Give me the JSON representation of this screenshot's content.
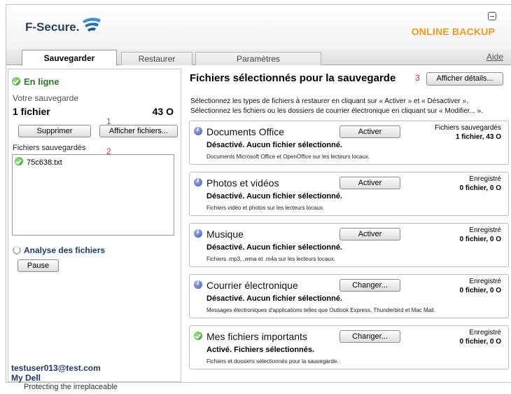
{
  "header": {
    "logo_text": "F-Secure.",
    "brand": "ONLINE BACKUP"
  },
  "tabs": [
    {
      "label": "Sauvegarder",
      "active": true
    },
    {
      "label": "Restaurer",
      "active": false
    },
    {
      "label": "Paramètres",
      "active": false
    }
  ],
  "help_label": "Aide",
  "left": {
    "status": "En ligne",
    "backup_label": "Votre sauvegarde",
    "file_count": "1 fichier",
    "size": "43 O",
    "delete_button": "Supprimer",
    "show_files_button": "Afficher fichiers...",
    "marker_1": "1",
    "marker_2": "2",
    "saved_files_label": "Fichiers sauvegardés",
    "files": [
      "75c638.txt"
    ],
    "analysis_label": "Analyse des fichiers",
    "pause_button": "Pause",
    "user_email": "testuser013@test.com",
    "user_link": "My Dell"
  },
  "main": {
    "title": "Fichiers sélectionnés pour la sauvegarde",
    "marker_3": "3",
    "details_button": "Afficher détails...",
    "desc_line1": "Sélectionnez les types de fichiers à restaurer en cliquant sur « Activer » et « Désactiver ».",
    "desc_line2": "Sélectionnez les fichiers ou les dossiers de courrier électronique en cliquant sur « Modifier... ».",
    "cards": [
      {
        "title": "Documents Office",
        "state": "Désactivé. Aucun fichier sélectionné.",
        "desc": "Documents Microsoft Office et OpenOffice sur les lecteurs locaux.",
        "button": "Activer",
        "right_label": "Fichiers sauvegardés",
        "right_value": "1 fichier, 43 O",
        "icon": "info-icon"
      },
      {
        "title": "Photos et vidéos",
        "state": "Désactivé. Aucun fichier sélectionné.",
        "desc": "Fichiers vidéo et photos sur les lecteurs locaux.",
        "button": "Activer",
        "right_label": "Enregistré",
        "right_value": "0 fichier, 0 O",
        "icon": "info-icon"
      },
      {
        "title": "Musique",
        "state": "Désactivé. Aucun fichier sélectionné.",
        "desc": "Fichiers .mp3, .wma et .m4a sur les lecteurs locaux.",
        "button": "Activer",
        "right_label": "Enregistré",
        "right_value": "0 fichier, 0 O",
        "icon": "info-icon"
      },
      {
        "title": "Courrier électronique",
        "state": "Désactivé. Aucun fichier sélectionné.",
        "desc": "Messages électroniques d'applications telles que Outlook Express, Thunderbird et Mac Mail.",
        "button": "Changer...",
        "right_label": "Enregistré",
        "right_value": "0 fichier, 0 O",
        "icon": "info-icon"
      },
      {
        "title": "Mes fichiers importants",
        "state": "Activé. Fichiers sélectionnés.",
        "desc": "Fichiers et dossiers sélectionnés pour la sauvegarde.",
        "button": "Changer...",
        "right_label": "Enregistré",
        "right_value": "0 fichier, 0 O",
        "icon": "ok-icon"
      }
    ]
  },
  "footer_tagline": "Protecting the irreplaceable"
}
